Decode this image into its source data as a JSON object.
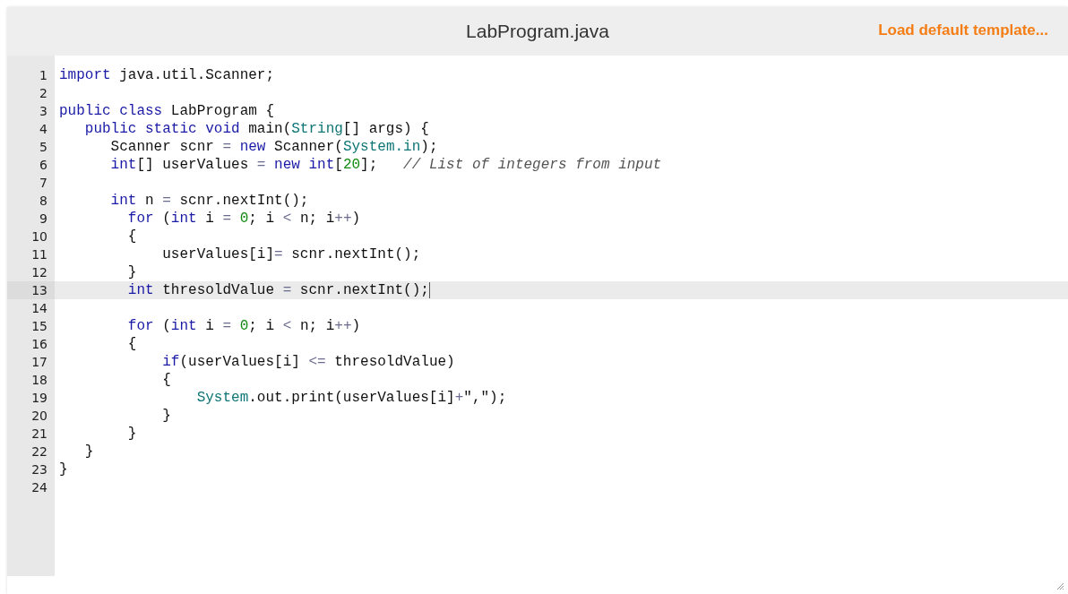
{
  "header": {
    "file_name": "LabProgram.java",
    "template_link": "Load default template..."
  },
  "editor": {
    "lines": [
      {
        "number": "1",
        "active": false,
        "tokens": [
          {
            "kind": "keyword",
            "text": "import"
          },
          {
            "kind": "plain",
            "text": " java.util.Scanner;"
          }
        ]
      },
      {
        "number": "2",
        "active": false
      },
      {
        "number": "3",
        "active": false,
        "tokens": [
          {
            "kind": "keyword",
            "text": "public class"
          },
          {
            "kind": "plain",
            "text": " LabProgram {"
          }
        ]
      },
      {
        "number": "4",
        "active": false,
        "tokens": [
          {
            "kind": "keyword",
            "text": "   public static void"
          },
          {
            "kind": "plain",
            "text": " main("
          },
          {
            "kind": "type",
            "text": "String"
          },
          {
            "kind": "plain",
            "text": "[] args) {"
          }
        ]
      },
      {
        "number": "5",
        "active": false,
        "tokens": [
          {
            "kind": "plain",
            "text": "      Scanner scnr "
          },
          {
            "kind": "operator",
            "text": "="
          },
          {
            "kind": "keyword",
            "text": " new"
          },
          {
            "kind": "plain",
            "text": " Scanner("
          },
          {
            "kind": "type",
            "text": "System.in"
          },
          {
            "kind": "plain",
            "text": ");"
          }
        ]
      },
      {
        "number": "6",
        "active": false,
        "tokens": [
          {
            "kind": "keyword",
            "text": "      int"
          },
          {
            "kind": "plain",
            "text": "[] userValues "
          },
          {
            "kind": "operator",
            "text": "="
          },
          {
            "kind": "keyword",
            "text": " new int"
          },
          {
            "kind": "plain",
            "text": "["
          },
          {
            "kind": "number",
            "text": "20"
          },
          {
            "kind": "plain",
            "text": "];   "
          },
          {
            "kind": "comment",
            "text": "// List of integers from input"
          }
        ]
      },
      {
        "number": "7",
        "active": false
      },
      {
        "number": "8",
        "active": false,
        "tokens": [
          {
            "kind": "keyword",
            "text": "      int"
          },
          {
            "kind": "plain",
            "text": " n "
          },
          {
            "kind": "operator",
            "text": "="
          },
          {
            "kind": "plain",
            "text": " scnr.nextInt();"
          }
        ]
      },
      {
        "number": "9",
        "active": false,
        "tokens": [
          {
            "kind": "keyword",
            "text": "        for"
          },
          {
            "kind": "plain",
            "text": " ("
          },
          {
            "kind": "keyword",
            "text": "int"
          },
          {
            "kind": "plain",
            "text": " i "
          },
          {
            "kind": "operator",
            "text": "="
          },
          {
            "kind": "number",
            "text": " 0"
          },
          {
            "kind": "plain",
            "text": "; i "
          },
          {
            "kind": "operator",
            "text": "<"
          },
          {
            "kind": "plain",
            "text": " n; i"
          },
          {
            "kind": "operator",
            "text": "++"
          },
          {
            "kind": "plain",
            "text": ")"
          }
        ]
      },
      {
        "number": "10",
        "active": false,
        "tokens": [
          {
            "kind": "plain",
            "text": "        {"
          }
        ]
      },
      {
        "number": "11",
        "active": false,
        "tokens": [
          {
            "kind": "plain",
            "text": "            userValues[i]"
          },
          {
            "kind": "operator",
            "text": "="
          },
          {
            "kind": "plain",
            "text": " scnr.nextInt();"
          }
        ]
      },
      {
        "number": "12",
        "active": false,
        "tokens": [
          {
            "kind": "plain",
            "text": "        }"
          }
        ]
      },
      {
        "number": "13",
        "active": true,
        "tokens": [
          {
            "kind": "keyword",
            "text": "        int"
          },
          {
            "kind": "plain",
            "text": " thresoldValue "
          },
          {
            "kind": "operator",
            "text": "="
          },
          {
            "kind": "plain",
            "text": " scnr.nextInt();"
          }
        ]
      },
      {
        "number": "14",
        "active": false
      },
      {
        "number": "15",
        "active": false,
        "tokens": [
          {
            "kind": "keyword",
            "text": "        for"
          },
          {
            "kind": "plain",
            "text": " ("
          },
          {
            "kind": "keyword",
            "text": "int"
          },
          {
            "kind": "plain",
            "text": " i "
          },
          {
            "kind": "operator",
            "text": "="
          },
          {
            "kind": "number",
            "text": " 0"
          },
          {
            "kind": "plain",
            "text": "; i "
          },
          {
            "kind": "operator",
            "text": "<"
          },
          {
            "kind": "plain",
            "text": " n; i"
          },
          {
            "kind": "operator",
            "text": "++"
          },
          {
            "kind": "plain",
            "text": ")"
          }
        ]
      },
      {
        "number": "16",
        "active": false,
        "tokens": [
          {
            "kind": "plain",
            "text": "        {"
          }
        ]
      },
      {
        "number": "17",
        "active": false,
        "tokens": [
          {
            "kind": "keyword",
            "text": "            if"
          },
          {
            "kind": "plain",
            "text": "(userValues[i] "
          },
          {
            "kind": "operator",
            "text": "<="
          },
          {
            "kind": "plain",
            "text": " thresoldValue)"
          }
        ]
      },
      {
        "number": "18",
        "active": false,
        "tokens": [
          {
            "kind": "plain",
            "text": "            {"
          }
        ]
      },
      {
        "number": "19",
        "active": false,
        "tokens": [
          {
            "kind": "type",
            "text": "                System"
          },
          {
            "kind": "plain",
            "text": ".out.print(userValues[i]"
          },
          {
            "kind": "operator",
            "text": "+"
          },
          {
            "kind": "plain",
            "text": "\",\");"
          }
        ]
      },
      {
        "number": "20",
        "active": false,
        "tokens": [
          {
            "kind": "plain",
            "text": "            }"
          }
        ]
      },
      {
        "number": "21",
        "active": false,
        "tokens": [
          {
            "kind": "plain",
            "text": "        }"
          }
        ]
      },
      {
        "number": "22",
        "active": false,
        "tokens": [
          {
            "kind": "plain",
            "text": "   }"
          }
        ]
      },
      {
        "number": "23",
        "active": false,
        "tokens": [
          {
            "kind": "plain",
            "text": "}"
          }
        ]
      },
      {
        "number": "24",
        "active": false
      }
    ]
  }
}
